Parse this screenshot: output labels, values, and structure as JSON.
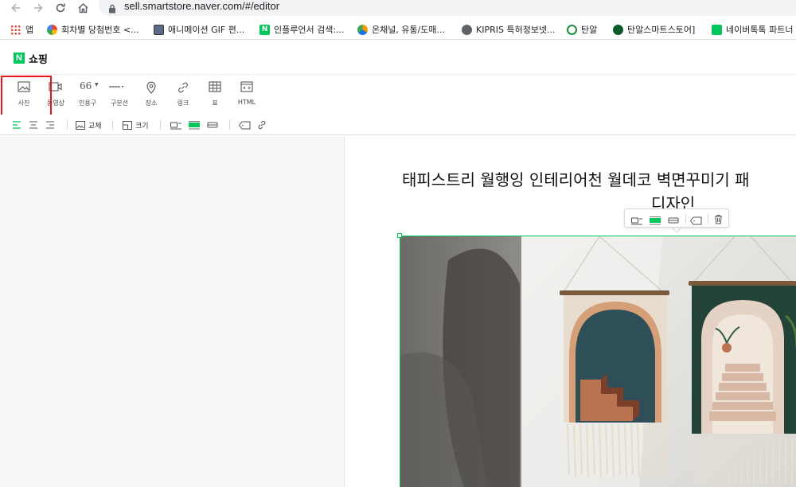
{
  "browser": {
    "url": "sell.smartstore.naver.com/#/editor",
    "bookmarks": [
      {
        "label": "앱",
        "icon": "apps-grid-icon"
      },
      {
        "label": "회차별 당첨번호 <...",
        "icon": "pinwheel-icon"
      },
      {
        "label": "애니메이션 GIF 편...",
        "icon": "gif-editor-icon"
      },
      {
        "label": "인플루언서 검색:...",
        "icon": "naver-n-icon"
      },
      {
        "label": "온채널, 유통/도매...",
        "icon": "onchannel-icon"
      },
      {
        "label": "KIPRIS 특허정보넷...",
        "icon": "globe-icon"
      },
      {
        "label": "탄알",
        "icon": "shield-bookmark-icon"
      },
      {
        "label": "탄알스마트스토어]",
        "icon": "smartstore-icon"
      },
      {
        "label": "네이버톡톡 파트너",
        "icon": "talktalk-icon"
      }
    ]
  },
  "app": {
    "logo_letter": "N",
    "title": "쇼핑"
  },
  "toolbar": {
    "items": [
      {
        "label": "사진",
        "icon": "image-icon"
      },
      {
        "label": "동영상",
        "icon": "video-icon"
      },
      {
        "label": "인용구",
        "icon": "quote-icon",
        "glyph": "66"
      },
      {
        "label": "구분선",
        "icon": "divider-icon"
      },
      {
        "label": "장소",
        "icon": "place-pin-icon"
      },
      {
        "label": "링크",
        "icon": "link-icon"
      },
      {
        "label": "표",
        "icon": "table-icon"
      },
      {
        "label": "HTML",
        "icon": "html-icon"
      }
    ]
  },
  "toolbar2": {
    "replace_label": "교체",
    "size_label": "크기"
  },
  "document": {
    "title_line1": "태피스트리 월행잉 인테리어천 월데코 벽면꾸미기 패",
    "title_line2": "디자인"
  },
  "colors": {
    "accent": "#03c75a",
    "highlight": "#e8141c"
  }
}
